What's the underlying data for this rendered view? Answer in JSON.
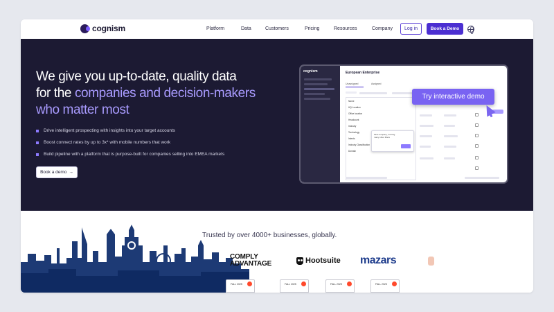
{
  "nav": {
    "brand": "cognism",
    "links": [
      "Platform",
      "Data",
      "Customers",
      "Pricing",
      "Resources",
      "Company"
    ],
    "login_label": "Log in",
    "book_label": "Book a Demo"
  },
  "hero": {
    "headline_1": "We give you up-to-date, quality data",
    "headline_2": "for the ",
    "headline_accent": "companies and decision-makers who matter most",
    "bullets": [
      "Drive intelligent prospecting with insights into your target accounts",
      "Boost connect rates by up to 3x* with mobile numbers that work",
      "Build pipeline with a platform that is purpose-built for companies selling into EMEA markets"
    ],
    "cta_label": "Book a demo",
    "cta_arrow": "→"
  },
  "mockup": {
    "brand": "cognism",
    "title": "European Enterprise",
    "tabs": [
      "Unassigned",
      "Assigned"
    ],
    "filter_items": [
      "Name",
      "HQ Location",
      "Office location",
      "Headcount",
      "Industry",
      "Technology",
      "Intents",
      "Industry Classification",
      "Domain"
    ],
    "tooltip": "Find company, running many other filters",
    "try_label": "Try interactive demo"
  },
  "trusted": {
    "text": "Trusted by over 4000+ businesses, globally.",
    "logos": {
      "comply_1": "COMPLY",
      "comply_2": "ADVANTAGE",
      "hootsuite": "Hootsuite",
      "mazars": "mazars"
    },
    "badge_label": "FALL 2025"
  },
  "colors": {
    "brand_purple": "#4b2fd1",
    "hero_bg": "#1c1a33",
    "accent_text": "#a99bff",
    "skyline": "#1d3a75"
  }
}
